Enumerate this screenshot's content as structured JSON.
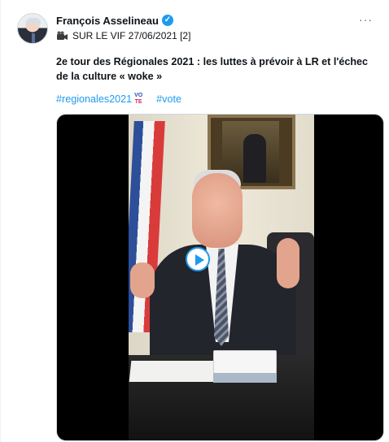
{
  "tweet": {
    "author_name": "François Asselineau",
    "verified_mark": "✓",
    "subline": "SUR LE VIF 27/06/2021 [2]",
    "more_label": "···",
    "text": "2e tour des Régionales 2021 : les luttes à prévoir à LR et l'échec de la culture « woke »",
    "hashtags": [
      "#regionales2021",
      "#vote"
    ],
    "vote_emoji": {
      "line1": "VO",
      "line2": "TE"
    }
  },
  "colors": {
    "accent": "#1d9bf0",
    "text": "#0f1419",
    "muted": "#536471"
  },
  "icons": {
    "subline_icon": "movie-camera-icon",
    "verified": "verified-badge-icon",
    "more": "more-options-icon",
    "play": "play-icon"
  }
}
